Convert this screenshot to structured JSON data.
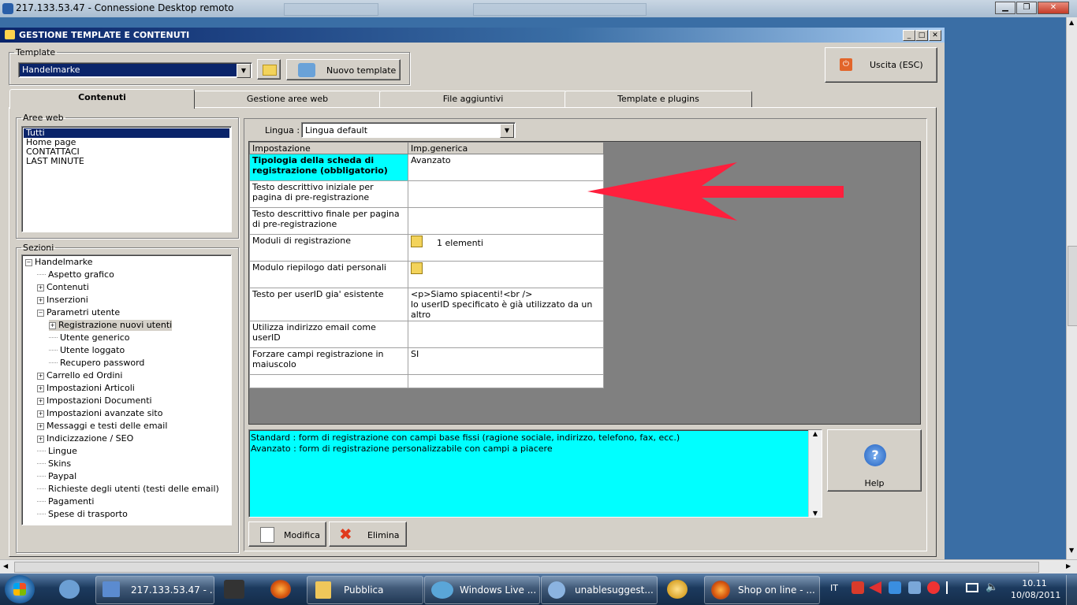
{
  "rdp": {
    "title": "217.133.53.47",
    "title_suffix": "Connessione Desktop remoto"
  },
  "app": {
    "title": "GESTIONE TEMPLATE E CONTENUTI",
    "template_group": "Template",
    "template_value": "Handelmarke",
    "new_template": "Nuovo template",
    "exit": "Uscita (ESC)",
    "tabs": [
      "Contenuti",
      "Gestione aree web",
      "File aggiuntivi",
      "Template e plugins"
    ],
    "areas_group": "Aree web",
    "areas": [
      "Tutti",
      "Home page",
      "CONTATTACI",
      "LAST MINUTE"
    ],
    "sections_group": "Sezioni",
    "tree": [
      {
        "label": "Handelmarke",
        "level": 0,
        "expand": "−"
      },
      {
        "label": "Aspetto grafico",
        "level": 1,
        "expand": ""
      },
      {
        "label": "Contenuti",
        "level": 1,
        "expand": "+"
      },
      {
        "label": "Inserzioni",
        "level": 1,
        "expand": "+"
      },
      {
        "label": "Parametri utente",
        "level": 1,
        "expand": "−"
      },
      {
        "label": "Registrazione nuovi utenti",
        "level": 2,
        "expand": "+",
        "selected": true
      },
      {
        "label": "Utente generico",
        "level": 2,
        "expand": ""
      },
      {
        "label": "Utente loggato",
        "level": 2,
        "expand": ""
      },
      {
        "label": "Recupero password",
        "level": 2,
        "expand": ""
      },
      {
        "label": "Carrello ed Ordini",
        "level": 1,
        "expand": "+"
      },
      {
        "label": "Impostazioni Articoli",
        "level": 1,
        "expand": "+"
      },
      {
        "label": "Impostazioni Documenti",
        "level": 1,
        "expand": "+"
      },
      {
        "label": "Impostazioni avanzate sito",
        "level": 1,
        "expand": "+"
      },
      {
        "label": "Messaggi e testi delle email",
        "level": 1,
        "expand": "+"
      },
      {
        "label": "Indicizzazione / SEO",
        "level": 1,
        "expand": "+"
      },
      {
        "label": "Lingue",
        "level": 1,
        "expand": ""
      },
      {
        "label": "Skins",
        "level": 1,
        "expand": ""
      },
      {
        "label": "Paypal",
        "level": 1,
        "expand": ""
      },
      {
        "label": "Richieste degli utenti (testi delle email)",
        "level": 1,
        "expand": ""
      },
      {
        "label": "Pagamenti",
        "level": 1,
        "expand": ""
      },
      {
        "label": "Spese di trasporto",
        "level": 1,
        "expand": ""
      }
    ],
    "language_label": "Lingua :",
    "language_value": "Lingua default",
    "grid_headers": [
      "Impostazione",
      "Imp.generica"
    ],
    "grid_rows": [
      {
        "setting": "Tipologia della scheda di registrazione (obbligatorio)",
        "value": "Avanzato",
        "value2": "",
        "highlight": true,
        "icon": false
      },
      {
        "setting": "Testo descrittivo iniziale per pagina di pre-registrazione",
        "value": "",
        "value2": "",
        "highlight": false,
        "icon": false
      },
      {
        "setting": "Testo descrittivo finale per pagina di pre-registrazione",
        "value": "",
        "value2": "",
        "highlight": false,
        "icon": false
      },
      {
        "setting": "Moduli di registrazione",
        "value": "1 elementi",
        "value2": "",
        "highlight": false,
        "icon": true
      },
      {
        "setting": "Modulo riepilogo dati personali",
        "value": "",
        "value2": "",
        "highlight": false,
        "icon": true
      },
      {
        "setting": "Testo per userID gia' esistente",
        "value": "<p>Siamo spiacenti!<br />",
        "value2": "lo userID specificato è già utilizzato da un altro",
        "highlight": false,
        "icon": false
      },
      {
        "setting": "Utilizza indirizzo email come userID",
        "value": "",
        "value2": "",
        "highlight": false,
        "icon": false
      },
      {
        "setting": "Forzare campi registrazione in maiuscolo",
        "value": "SI",
        "value2": "",
        "highlight": false,
        "icon": false
      }
    ],
    "info_lines": [
      "Standard : form di registrazione con campi base fissi (ragione sociale, indirizzo, telefono, fax, ecc.)",
      "Avanzato : form di registrazione personalizzabile con campi a piacere"
    ],
    "help": "Help",
    "modify": "Modifica",
    "delete": "Elimina"
  },
  "taskbar": {
    "items": [
      "217.133.53.47 - ...",
      "Pubblica",
      "Windows Live ...",
      "unablesuggest...",
      "Shop on line - ..."
    ],
    "lang": "IT",
    "time": "10.11",
    "date": "10/08/2011"
  },
  "colors": {
    "highlight_cell": "#00ffff",
    "info_bg": "#00ffff",
    "arrow": "#ff1f3d",
    "selection": "#0a246a"
  }
}
